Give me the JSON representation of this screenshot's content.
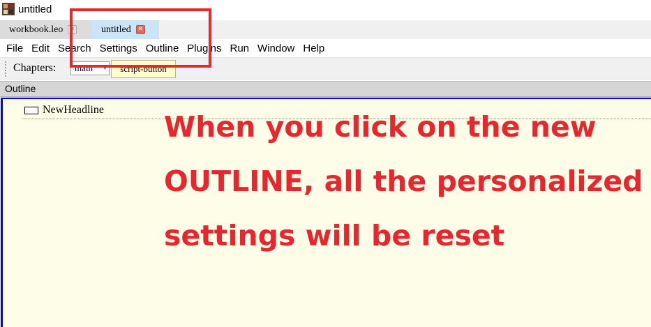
{
  "window": {
    "title": "untitled",
    "icon": "leo-app-icon"
  },
  "tabs": [
    {
      "label": "workbook.leo",
      "close": "✕",
      "active": false
    },
    {
      "label": "untitled",
      "close": "✕",
      "active": true
    }
  ],
  "menu": {
    "items": [
      "File",
      "Edit",
      "Search",
      "Settings",
      "Outline",
      "Plugins",
      "Run",
      "Window",
      "Help"
    ]
  },
  "toolbar": {
    "chapters_label": "Chapters:",
    "chapter_value": "main",
    "script_button_label": "script-button"
  },
  "outline": {
    "header": "Outline",
    "nodes": [
      {
        "headline": "NewHeadline"
      }
    ]
  },
  "annotation": {
    "text": "When you click on the new OUTLINE, all the personalized settings will be reset",
    "color": "#e8262e"
  },
  "colors": {
    "active_tab": "#cce4f7",
    "outline_background": "#fefee8",
    "focus_border": "#0000ff",
    "script_button": "#ffffcc"
  }
}
